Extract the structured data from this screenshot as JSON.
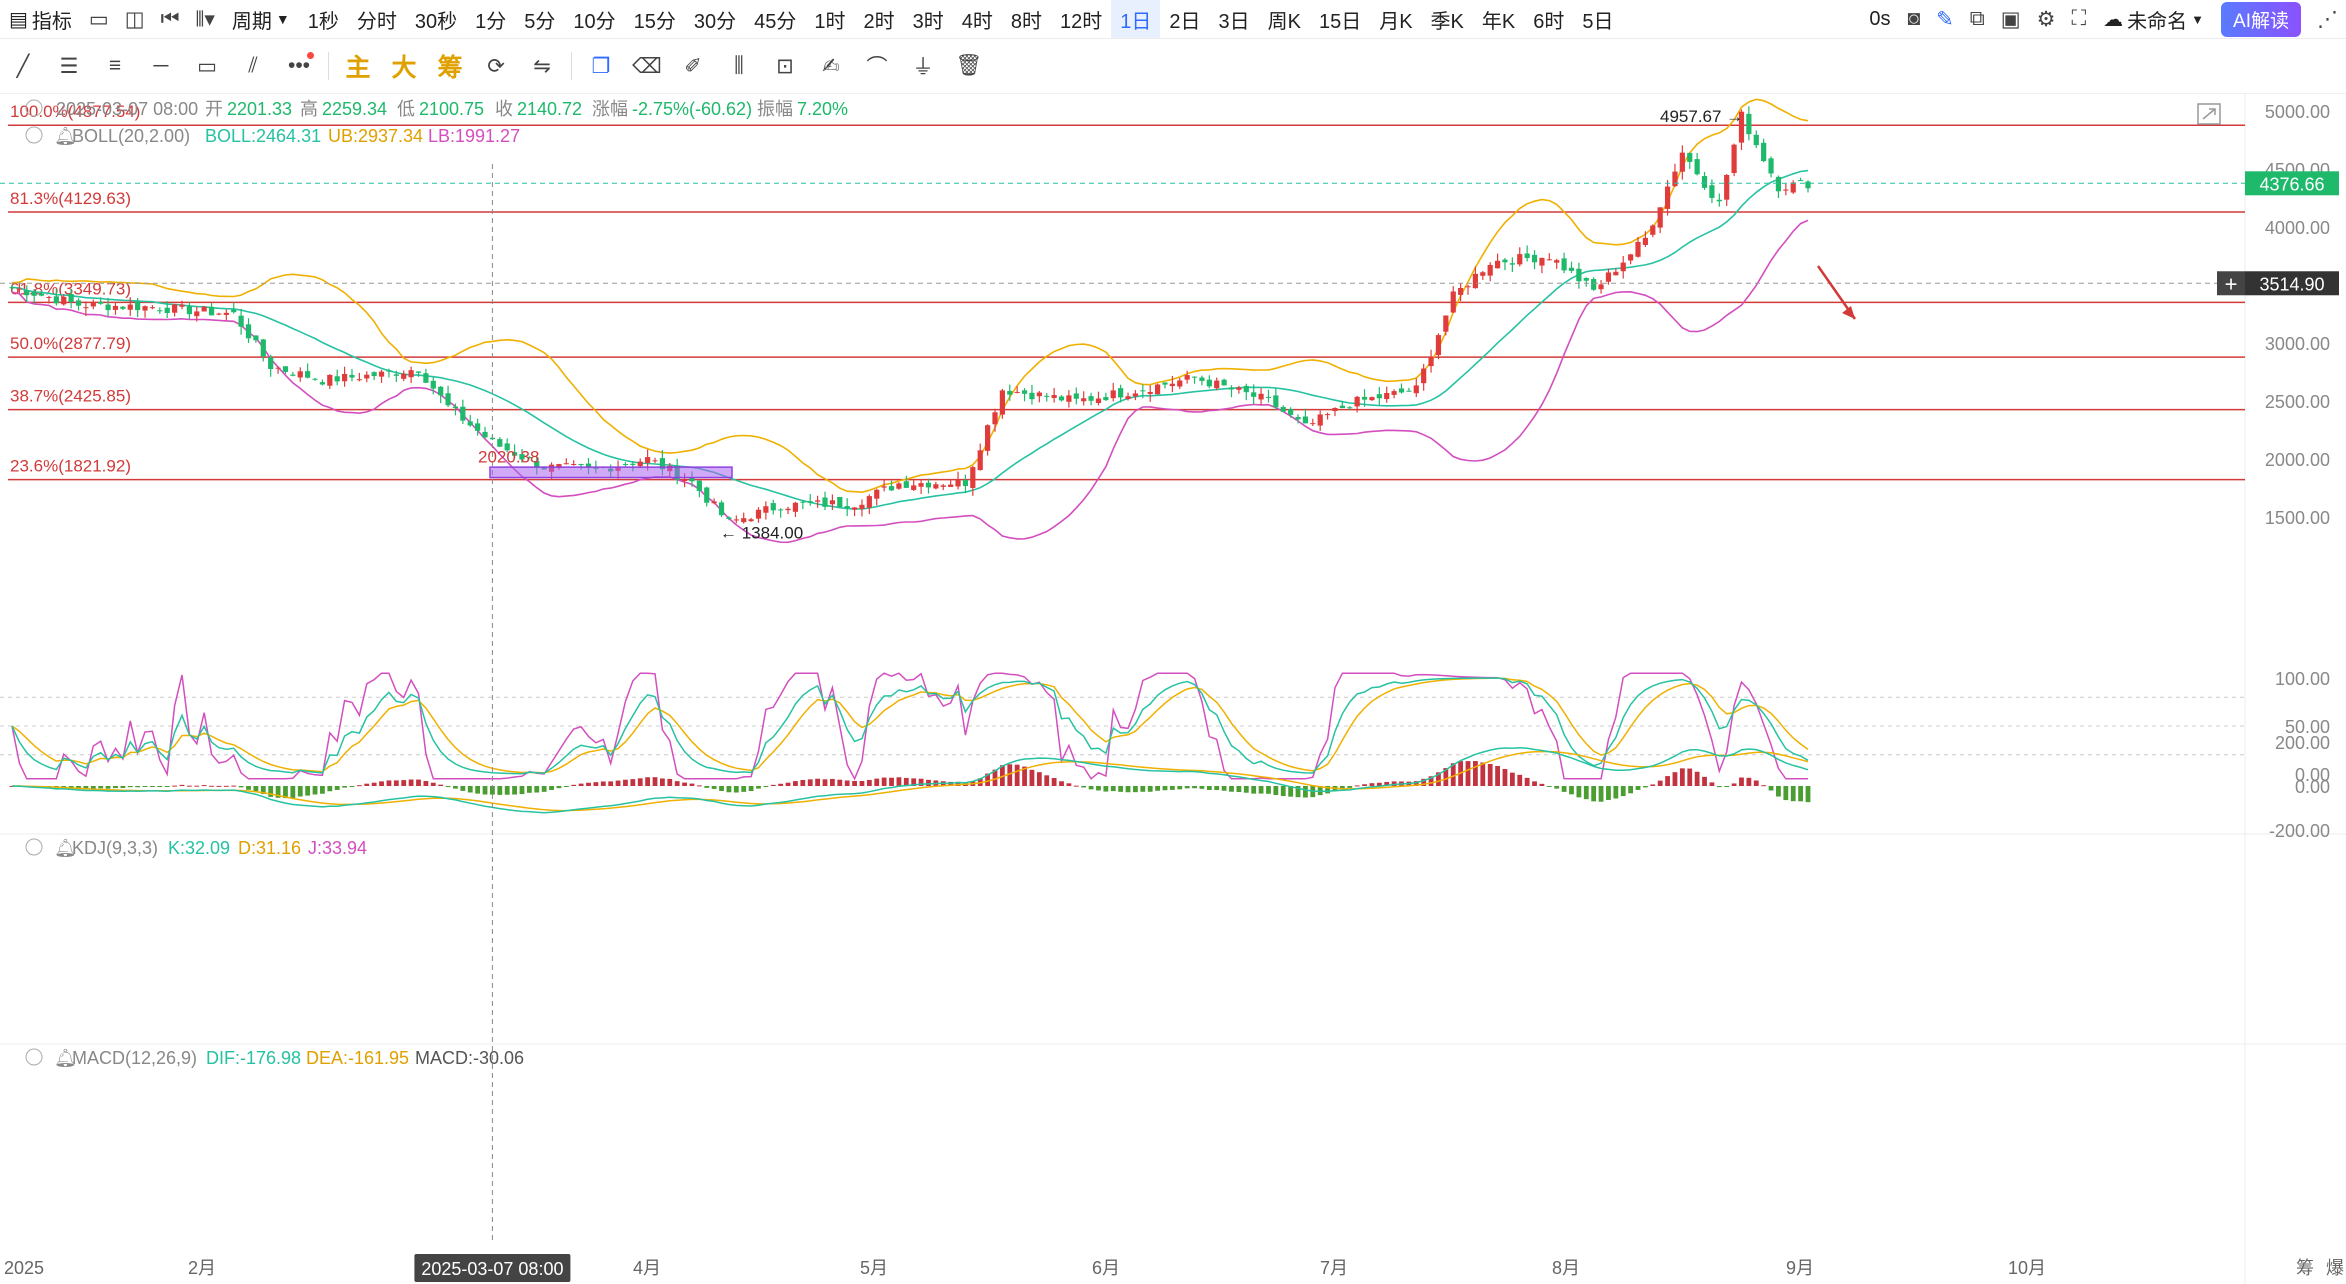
{
  "toolbar": {
    "indicator_label": "指标",
    "period_label": "周期",
    "periods": [
      "1秒",
      "分时",
      "30秒",
      "1分",
      "5分",
      "10分",
      "15分",
      "30分",
      "45分",
      "1时",
      "2时",
      "3时",
      "4时",
      "8时",
      "12时",
      "1日",
      "2日",
      "3日",
      "周K",
      "15日",
      "月K",
      "季K",
      "年K",
      "6时",
      "5日"
    ],
    "active_period": "1日",
    "right": {
      "delay": "0s",
      "name": "未命名",
      "ai": "AI解读"
    }
  },
  "draw_tools": {
    "cn_labels": [
      "主",
      "大",
      "筹"
    ]
  },
  "info": {
    "ohlc_line": {
      "date": "2025-03-07 08:00",
      "open_label": "开",
      "open": "2201.33",
      "high_label": "高",
      "high": "2259.34",
      "low_label": "低",
      "low": "2100.75",
      "close_label": "收",
      "close": "2140.72",
      "chg_label": "涨幅",
      "chg": "-2.75%(-60.62)",
      "amp_label": "振幅",
      "amp": "7.20%"
    },
    "boll_line": {
      "name": "BOLL(20,2.00)",
      "mid": "BOLL:2464.31",
      "ub": "UB:2937.34",
      "lb": "LB:1991.27"
    },
    "kdj_line": {
      "name": "KDJ(9,3,3)",
      "k": "K:32.09",
      "d": "D:31.16",
      "j": "J:33.94"
    },
    "macd_line": {
      "name": "MACD(12,26,9)",
      "dif": "DIF:-176.98",
      "dea": "DEA:-161.95",
      "macd": "MACD:-30.06"
    }
  },
  "colors": {
    "up": "#e03c3c",
    "down": "#1eb96b",
    "hist_up": "#b80f1d",
    "hist_down": "#2a8c0c",
    "boll_mid": "#26c2a2",
    "boll_ub": "#f0b000",
    "boll_lb": "#d34fbf",
    "k": "#26c2a2",
    "d": "#f0b000",
    "j": "#d34fbf",
    "fib": "#d23a3a",
    "axis": "#888888",
    "accent": "#2f6bff"
  },
  "chart_data": {
    "type": "candlestick",
    "price_axis": {
      "ticks": [
        "5000.00",
        "4500.00",
        "4000.00",
        "3500.00",
        "3000.00",
        "2500.00",
        "2000.00",
        "1500.00"
      ],
      "ylim": [
        1300,
        5200
      ]
    },
    "kdj_axis": {
      "ticks": [
        "100.00",
        "50.00",
        "0.00"
      ]
    },
    "macd_axis": {
      "ticks": [
        "200.00",
        "0.00",
        "-200.00"
      ]
    },
    "x_labels": [
      "2025",
      "2月",
      "4月",
      "5月",
      "6月",
      "7月",
      "8月",
      "9月",
      "10月"
    ],
    "crosshair_date": "2025-03-07 08:00",
    "current_price": "4376.66",
    "cursor_price": "3514.90",
    "fib_levels": [
      {
        "label": "100.0%(4877.54)",
        "value": 4877.54
      },
      {
        "label": "81.3%(4129.63)",
        "value": 4129.63
      },
      {
        "label": "61.8%(3349.73)",
        "value": 3349.73
      },
      {
        "label": "50.0%(2877.79)",
        "value": 2877.79
      },
      {
        "label": "38.7%(2425.85)",
        "value": 2425.85
      },
      {
        "label": "23.6%(1821.92)",
        "value": 1821.92
      }
    ],
    "annotations": {
      "high": "4957.67",
      "low": "1384.00",
      "mid_label": "2020.38"
    },
    "close_path": [
      [
        "2025-01-01",
        3480
      ],
      [
        "2025-01-10",
        3330
      ],
      [
        "2025-01-20",
        3310
      ],
      [
        "2025-01-31",
        3250
      ],
      [
        "2025-02-05",
        2800
      ],
      [
        "2025-02-12",
        2680
      ],
      [
        "2025-02-20",
        2730
      ],
      [
        "2025-02-25",
        2780
      ],
      [
        "2025-03-01",
        2450
      ],
      [
        "2025-03-07",
        2140
      ],
      [
        "2025-03-14",
        1930
      ],
      [
        "2025-03-21",
        1910
      ],
      [
        "2025-03-28",
        2000
      ],
      [
        "2025-04-03",
        1800
      ],
      [
        "2025-04-08",
        1450
      ],
      [
        "2025-04-15",
        1600
      ],
      [
        "2025-04-25",
        1620
      ],
      [
        "2025-05-01",
        1790
      ],
      [
        "2025-05-10",
        1800
      ],
      [
        "2025-05-15",
        2600
      ],
      [
        "2025-05-25",
        2500
      ],
      [
        "2025-06-01",
        2580
      ],
      [
        "2025-06-10",
        2700
      ],
      [
        "2025-06-20",
        2500
      ],
      [
        "2025-06-25",
        2270
      ],
      [
        "2025-07-01",
        2480
      ],
      [
        "2025-07-10",
        2600
      ],
      [
        "2025-07-15",
        3400
      ],
      [
        "2025-07-20",
        3700
      ],
      [
        "2025-07-28",
        3750
      ],
      [
        "2025-08-03",
        3450
      ],
      [
        "2025-08-10",
        3900
      ],
      [
        "2025-08-15",
        4650
      ],
      [
        "2025-08-20",
        4200
      ],
      [
        "2025-08-23",
        4957.67
      ],
      [
        "2025-08-28",
        4350
      ],
      [
        "2025-09-01",
        4376.66
      ]
    ]
  }
}
